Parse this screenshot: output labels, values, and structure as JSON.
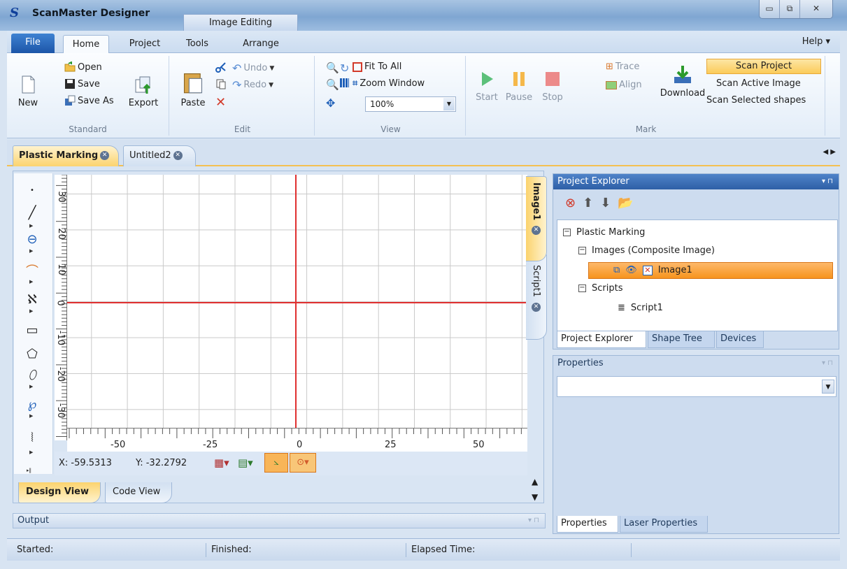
{
  "window": {
    "app_title": "ScanMaster Designer",
    "logo": "S",
    "context_tab": "Image Editing",
    "min": "▭",
    "max": "⧉",
    "close": "✕"
  },
  "ribbon_tabs": {
    "file": "File",
    "home": "Home",
    "project": "Project",
    "tools": "Tools",
    "arrange": "Arrange",
    "help": "Help ▾"
  },
  "standard": {
    "new": "New",
    "open": "Open",
    "save": "Save",
    "save_as": "Save As",
    "export": "Export",
    "label": "Standard"
  },
  "edit": {
    "paste": "Paste",
    "undo": "Undo",
    "redo": "Redo",
    "label": "Edit"
  },
  "view": {
    "fit_all": "Fit To All",
    "zoom_window": "Zoom Window",
    "zoom_value": "100%",
    "label": "View"
  },
  "mark": {
    "start": "Start",
    "pause": "Pause",
    "stop": "Stop",
    "trace": "Trace",
    "align": "Align",
    "download": "Download",
    "scan_project": "Scan Project",
    "scan_active": "Scan Active Image",
    "scan_selected": "Scan Selected shapes",
    "label": "Mark"
  },
  "doc_tabs": [
    "Plastic Marking",
    "Untitled2"
  ],
  "side_tabs": [
    "Image1",
    "Script1"
  ],
  "canvas": {
    "v_labels": [
      "30",
      "20",
      "10",
      "0",
      "-10",
      "-20",
      "-30"
    ],
    "h_labels": [
      "-50",
      "-25",
      "0",
      "25",
      "50"
    ],
    "x_readout": "X:  -59.5313",
    "y_readout": "Y:  -32.2792"
  },
  "view_tabs": {
    "design": "Design View",
    "code": "Code View"
  },
  "output": {
    "label": "Output"
  },
  "status": {
    "started": "Started:",
    "finished": "Finished:",
    "elapsed": "Elapsed Time:"
  },
  "project_explorer": {
    "title": "Project Explorer",
    "root": "Plastic Marking",
    "images": "Images (Composite Image)",
    "image1": "Image1",
    "scripts": "Scripts",
    "script1": "Script1",
    "tabs": [
      "Project Explorer",
      "Shape Tree",
      "Devices"
    ]
  },
  "properties": {
    "title": "Properties",
    "tabs": [
      "Properties",
      "Laser Properties"
    ]
  }
}
